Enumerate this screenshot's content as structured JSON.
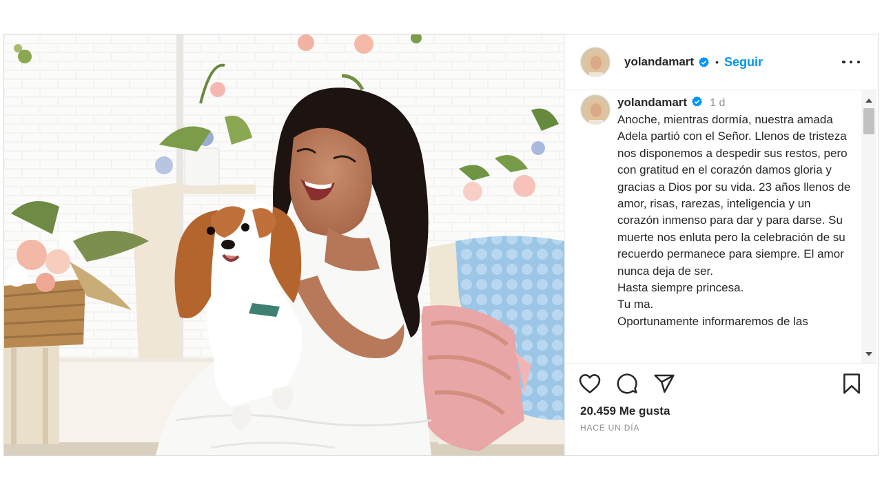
{
  "post": {
    "username": "yolandamart",
    "separator": "•",
    "follow_label": "Seguir",
    "caption_time": "1 d",
    "caption_text": "Anoche, mientras dormía, nuestra amada Adela partió con el Señor. Llenos de tristeza nos disponemos a despedir sus restos, pero con gratitud en el corazón damos gloria y gracias a Dios por su vida. 23 años llenos de amor, risas, rarezas, inteligencia y un corazón inmenso para dar y para darse. Su muerte nos enluta pero la celebración de su recuerdo permanece para siempre. El amor nunca deja de ser.\nHasta siempre princesa.\nTu ma.\nOportunamente informaremos de las",
    "likes_label": "20.459 Me gusta",
    "posted_ago": "HACE UN DÍA"
  },
  "icons": {
    "verified": "verified-badge-icon",
    "more": "more-options-icon",
    "like": "heart-icon",
    "comment": "comment-icon",
    "share": "paper-plane-icon",
    "save": "bookmark-icon"
  },
  "colors": {
    "accent": "#0095f6",
    "verified": "#0095f6",
    "text": "#262626",
    "muted": "#8e8e8e",
    "border": "#dbdbdb"
  }
}
